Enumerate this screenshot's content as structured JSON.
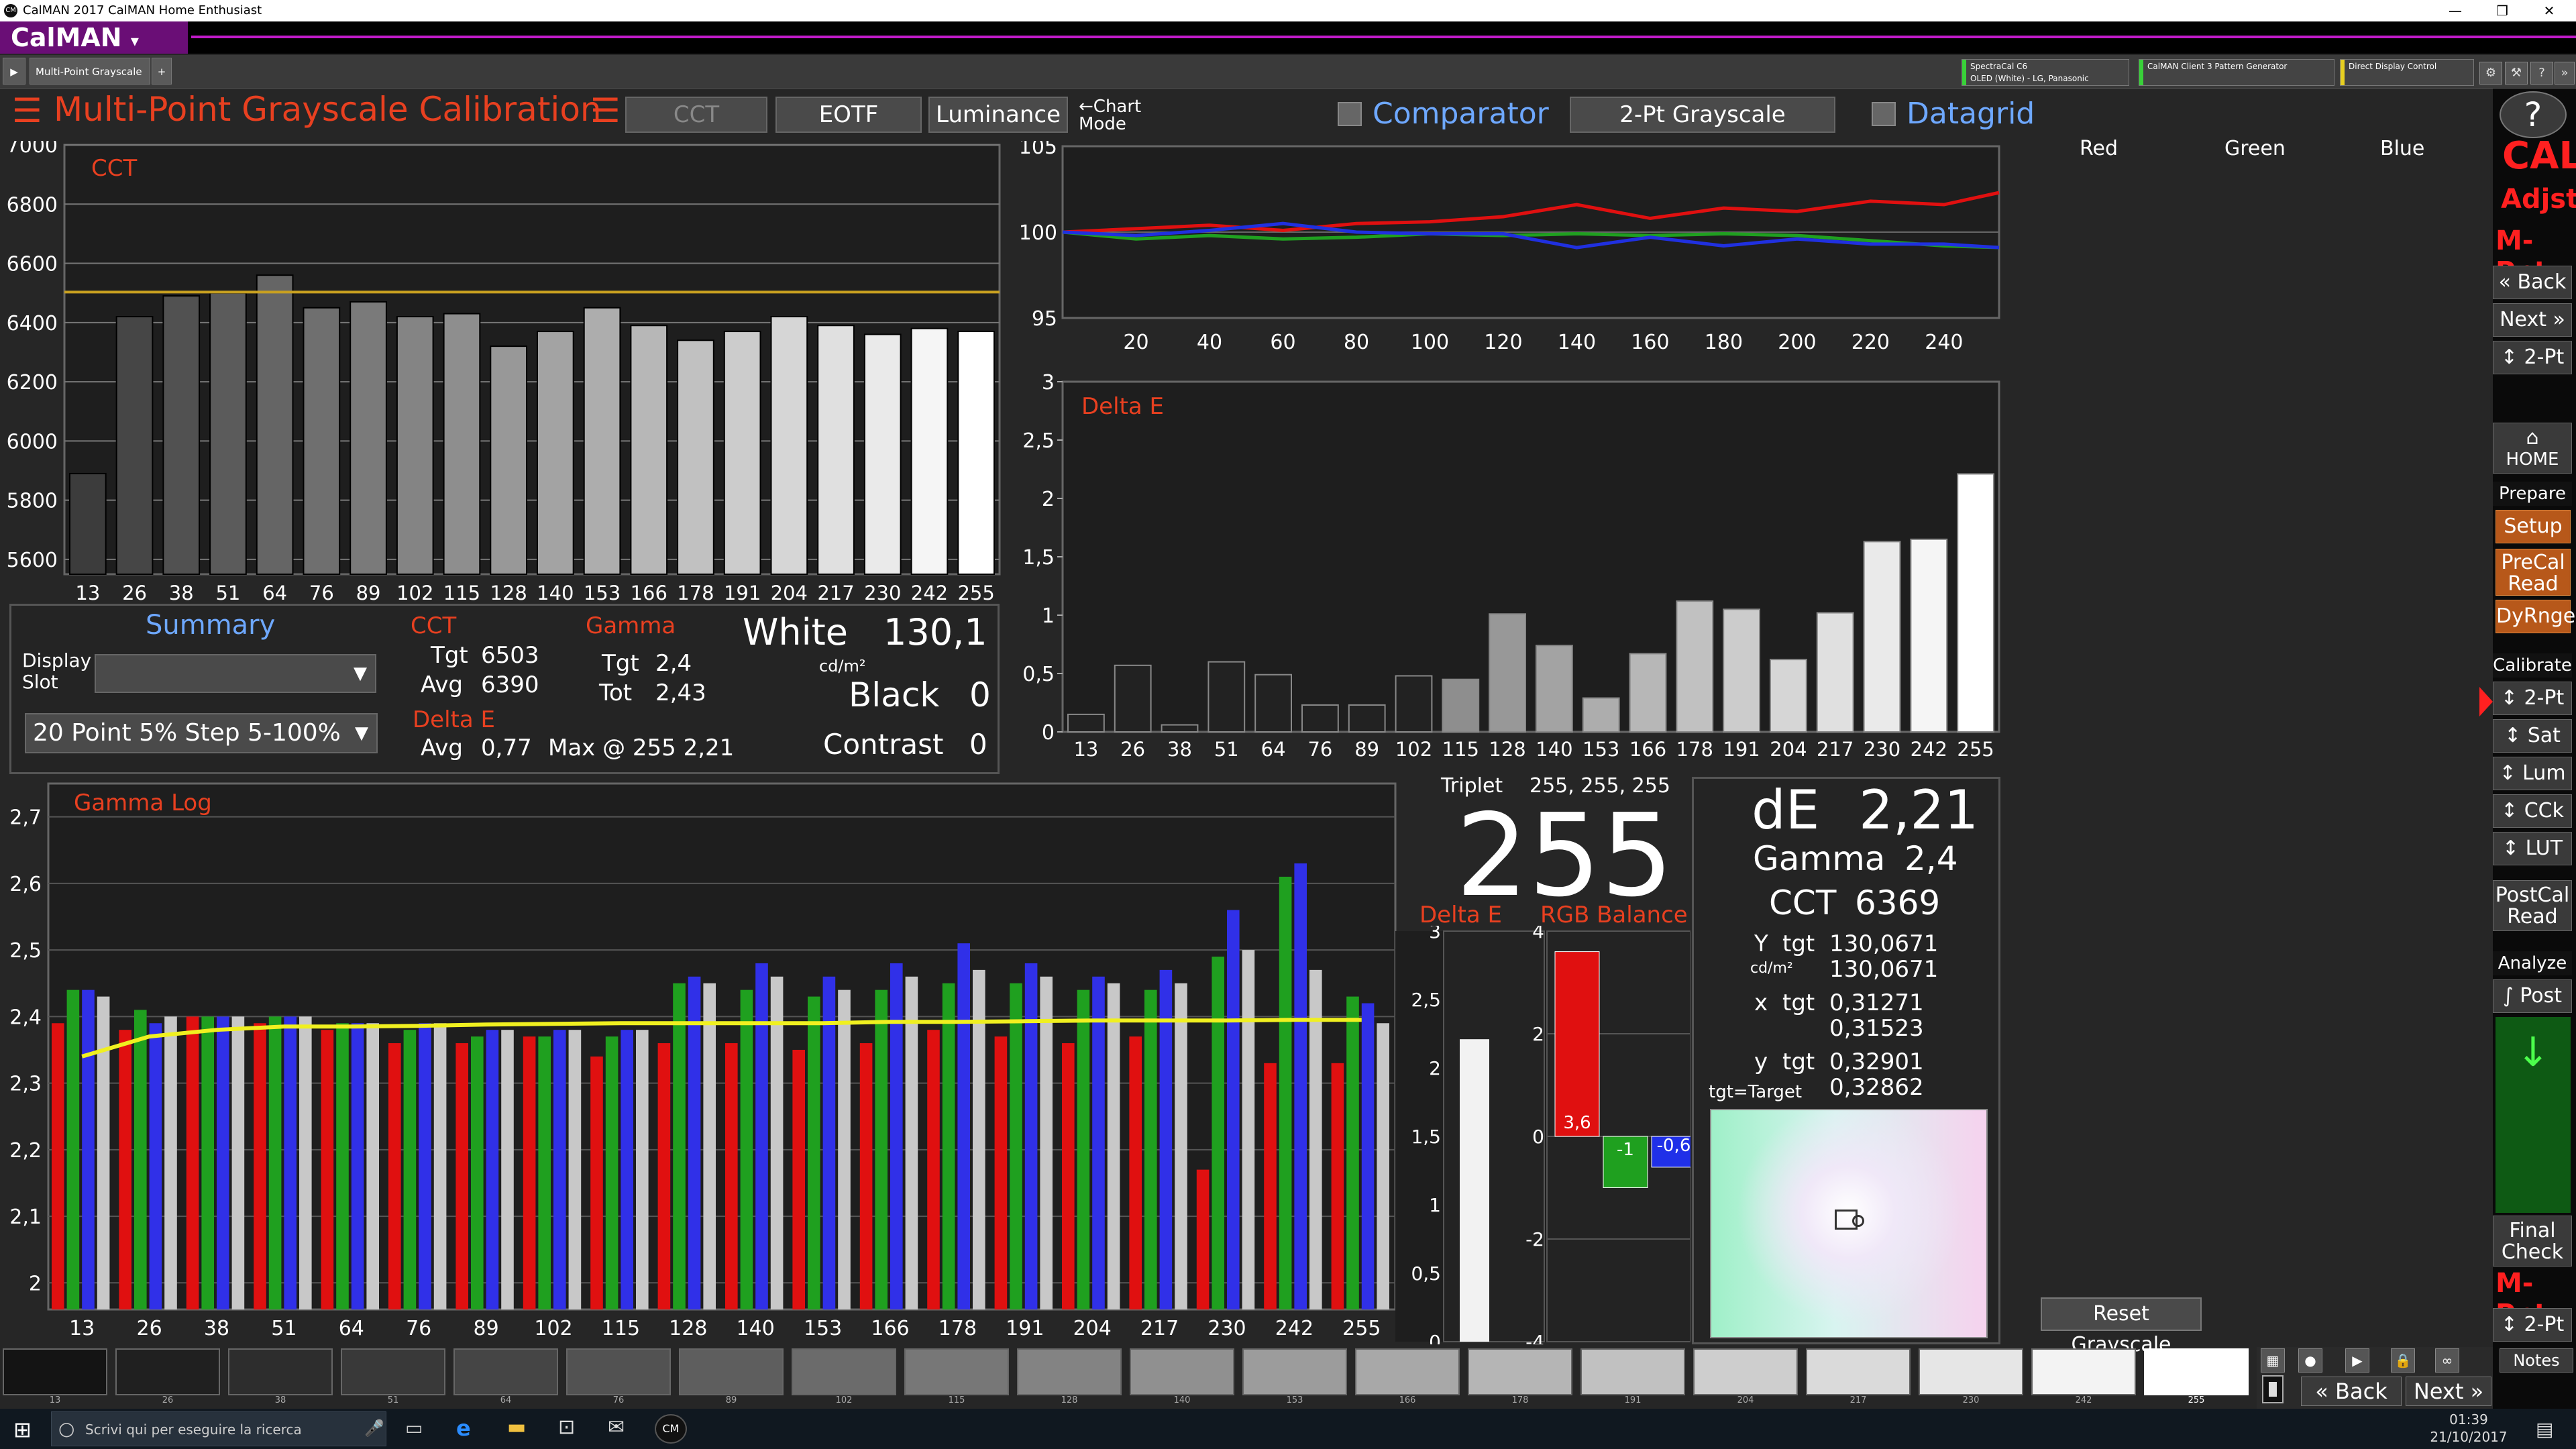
{
  "window": {
    "title": "CalMAN 2017 CalMAN Home Enthusiast",
    "logo_icon": "CM",
    "min": "—",
    "max": "❐",
    "close": "✕"
  },
  "app": {
    "logo": "CalMAN",
    "logo_arrow": "▾"
  },
  "tab": {
    "label": "Multi-Point Grayscale",
    "add": "+"
  },
  "devices": [
    {
      "line1": "SpectraCal C6",
      "line2": "OLED (White) - LG, Panasonic",
      "color": "#39d139"
    },
    {
      "line1": "CalMAN Client 3 Pattern Generator",
      "line2": "",
      "color": "#39d139"
    },
    {
      "line1": "Direct Display Control",
      "line2": "",
      "color": "#e8d020"
    }
  ],
  "header": {
    "menu_icon": "☰",
    "title": "Multi-Point Grayscale Calibration",
    "menu_icon2": "☰",
    "btn_cct": "CCT",
    "btn_eotf": "EOTF",
    "btn_lum": "Luminance",
    "chart_mode": "←Chart Mode",
    "comparator": "Comparator",
    "two_pt": "2-Pt Grayscale",
    "datagrid": "Datagrid"
  },
  "rgb_labels": {
    "red": "Red",
    "green": "Green",
    "blue": "Blue"
  },
  "summary": {
    "title": "Summary",
    "display_slot_label": "Display Slot",
    "display_slot_value": "",
    "point_select": "20 Point 5% Step 5-100%",
    "cct_title": "CCT",
    "cct_tgt_l": "Tgt",
    "cct_tgt": "6503",
    "cct_avg_l": "Avg",
    "cct_avg": "6390",
    "gamma_title": "Gamma",
    "gamma_tgt_l": "Tgt",
    "gamma_tgt": "2,4",
    "gamma_tot_l": "Tot",
    "gamma_tot": "2,43",
    "de_title": "Delta E",
    "de_avg_l": "Avg",
    "de_avg": "0,77",
    "de_max": "Max @ 255 2,21",
    "white_l": "White",
    "white": "130,1",
    "unit": "cd/m²",
    "black_l": "Black",
    "black": "0",
    "contrast_l": "Contrast",
    "contrast": "0"
  },
  "triplet": {
    "label": "Triplet",
    "rgb": "255, 255, 255",
    "big": "255",
    "de_label": "Delta E",
    "rgb_label": "RGB Balance",
    "red_val": "3,6",
    "green_val": "-1",
    "blue_val": "-0,6"
  },
  "readout": {
    "de_l": "dE",
    "de": "2,21",
    "gamma_l": "Gamma",
    "gamma": "2,4",
    "cct_l": "CCT",
    "cct": "6369",
    "y_l": "Y",
    "y_tgt_l": "tgt",
    "y_tgt": "130,0671",
    "y_unit": "cd/m²",
    "y_val": "130,0671",
    "x_l": "x",
    "x_tgt_l": "tgt",
    "x_tgt": "0,31271",
    "x_val": "0,31523",
    "yy_l": "y",
    "yy_tgt_l": "tgt",
    "yy_tgt": "0,32901",
    "yy_val": "0,32862",
    "legend": "tgt=Target"
  },
  "reset_btn": "Reset Grayscale",
  "sidebar": {
    "help": "?",
    "cal": "CAL",
    "adjst": "Adjst",
    "mpnt": "M-Pnt",
    "back": "Back",
    "next": "Next",
    "twopt": "2-Pt",
    "home": "HOME",
    "prepare": "Prepare",
    "setup": "Setup",
    "precal": "PreCal Read",
    "dyrnge": "DyRnge",
    "calibrate": "Calibrate",
    "c_2pt": "2-Pt",
    "sat": "Sat",
    "lum": "Lum",
    "cck": "CCk",
    "lut": "LUT",
    "postcal": "PostCal Read",
    "analyze": "Analyze",
    "post": "Post",
    "final": "Final Check",
    "mpnt2": "M-Pnt",
    "twopt2": "2-Pt"
  },
  "bottom": {
    "notes": "Notes",
    "back": "Back",
    "next": "Next"
  },
  "taskbar": {
    "search": "Scrivi qui per eseguire la ricerca",
    "time": "01:39",
    "date": "21/10/2017"
  },
  "swatches": [
    "13",
    "26",
    "38",
    "51",
    "64",
    "76",
    "89",
    "102",
    "115",
    "128",
    "140",
    "153",
    "166",
    "178",
    "191",
    "204",
    "217",
    "230",
    "242",
    "255"
  ],
  "chart_data": [
    {
      "type": "bar",
      "title": "CCT",
      "categories": [
        "13",
        "26",
        "38",
        "51",
        "64",
        "76",
        "89",
        "102",
        "115",
        "128",
        "140",
        "153",
        "166",
        "178",
        "191",
        "204",
        "217",
        "230",
        "242",
        "255"
      ],
      "values": [
        5890,
        6420,
        6490,
        6500,
        6560,
        6450,
        6470,
        6420,
        6430,
        6320,
        6370,
        6450,
        6390,
        6340,
        6370,
        6420,
        6390,
        6360,
        6380,
        6370
      ],
      "target": 6503,
      "ylim": [
        5550,
        7000
      ],
      "yticks": [
        5600,
        5800,
        6000,
        6200,
        6400,
        6600,
        6800,
        7000
      ]
    },
    {
      "type": "line",
      "title": "",
      "x": [
        0,
        20,
        40,
        60,
        80,
        100,
        120,
        140,
        160,
        180,
        200,
        220,
        240,
        255
      ],
      "ylim": [
        95,
        105
      ],
      "yticks": [
        95,
        100,
        105
      ],
      "xticks": [
        20,
        40,
        60,
        80,
        100,
        120,
        140,
        160,
        180,
        200,
        220,
        240
      ],
      "series": [
        {
          "color": "#e01010",
          "values": [
            100.0,
            100.2,
            100.4,
            100.1,
            100.5,
            100.6,
            100.9,
            101.6,
            100.8,
            101.4,
            101.2,
            101.8,
            101.6,
            102.3
          ]
        },
        {
          "color": "#20a020",
          "values": [
            100.0,
            99.6,
            99.8,
            99.6,
            99.7,
            99.9,
            99.8,
            99.9,
            99.8,
            99.9,
            99.8,
            99.5,
            99.2,
            99.1
          ]
        },
        {
          "color": "#2030e0",
          "values": [
            100.0,
            99.8,
            100.1,
            100.5,
            100.0,
            99.9,
            99.9,
            99.1,
            99.7,
            99.2,
            99.6,
            99.3,
            99.3,
            99.1
          ]
        }
      ]
    },
    {
      "type": "bar",
      "title": "Delta E",
      "categories": [
        "13",
        "26",
        "38",
        "51",
        "64",
        "76",
        "89",
        "102",
        "115",
        "128",
        "140",
        "153",
        "166",
        "178",
        "191",
        "204",
        "217",
        "230",
        "242",
        "255"
      ],
      "values": [
        0.15,
        0.57,
        0.06,
        0.6,
        0.49,
        0.23,
        0.23,
        0.48,
        0.45,
        1.01,
        0.74,
        0.29,
        0.67,
        1.12,
        1.05,
        0.62,
        1.02,
        1.63,
        1.65,
        2.21
      ],
      "ylim": [
        0,
        3
      ],
      "yticks": [
        "0",
        "0,5",
        "1",
        "1,5",
        "2",
        "2,5",
        "3"
      ]
    },
    {
      "type": "bar",
      "title": "Gamma Log",
      "categories": [
        "13",
        "26",
        "38",
        "51",
        "64",
        "76",
        "89",
        "102",
        "115",
        "128",
        "140",
        "153",
        "166",
        "178",
        "191",
        "204",
        "217",
        "230",
        "242",
        "255"
      ],
      "ylim": [
        1.96,
        2.75
      ],
      "yticks": [
        "2",
        "2,1",
        "2,2",
        "2,3",
        "2,4",
        "2,5",
        "2,6",
        "2,7"
      ],
      "series": [
        {
          "name": "Red",
          "values": [
            2.39,
            2.38,
            2.4,
            2.39,
            2.38,
            2.36,
            2.36,
            2.37,
            2.34,
            2.36,
            2.36,
            2.35,
            2.36,
            2.38,
            2.37,
            2.36,
            2.37,
            2.17,
            2.33,
            2.33
          ]
        },
        {
          "name": "Green",
          "values": [
            2.44,
            2.41,
            2.4,
            2.4,
            2.39,
            2.38,
            2.37,
            2.37,
            2.37,
            2.45,
            2.44,
            2.43,
            2.44,
            2.45,
            2.45,
            2.44,
            2.44,
            2.49,
            2.61,
            2.43
          ]
        },
        {
          "name": "Blue",
          "values": [
            2.44,
            2.39,
            2.4,
            2.4,
            2.39,
            2.39,
            2.38,
            2.38,
            2.38,
            2.46,
            2.48,
            2.46,
            2.48,
            2.51,
            2.48,
            2.46,
            2.47,
            2.56,
            2.63,
            2.42
          ]
        },
        {
          "name": "Gray",
          "values": [
            2.43,
            2.4,
            2.4,
            2.4,
            2.39,
            2.39,
            2.38,
            2.38,
            2.38,
            2.45,
            2.46,
            2.44,
            2.46,
            2.47,
            2.46,
            2.45,
            2.45,
            2.5,
            2.47,
            2.39
          ]
        }
      ],
      "line": [
        2.34,
        2.37,
        2.38,
        2.385,
        2.385,
        2.386,
        2.388,
        2.389,
        2.39,
        2.39,
        2.39,
        2.39,
        2.392,
        2.392,
        2.393,
        2.394,
        2.394,
        2.394,
        2.395,
        2.395
      ]
    }
  ]
}
